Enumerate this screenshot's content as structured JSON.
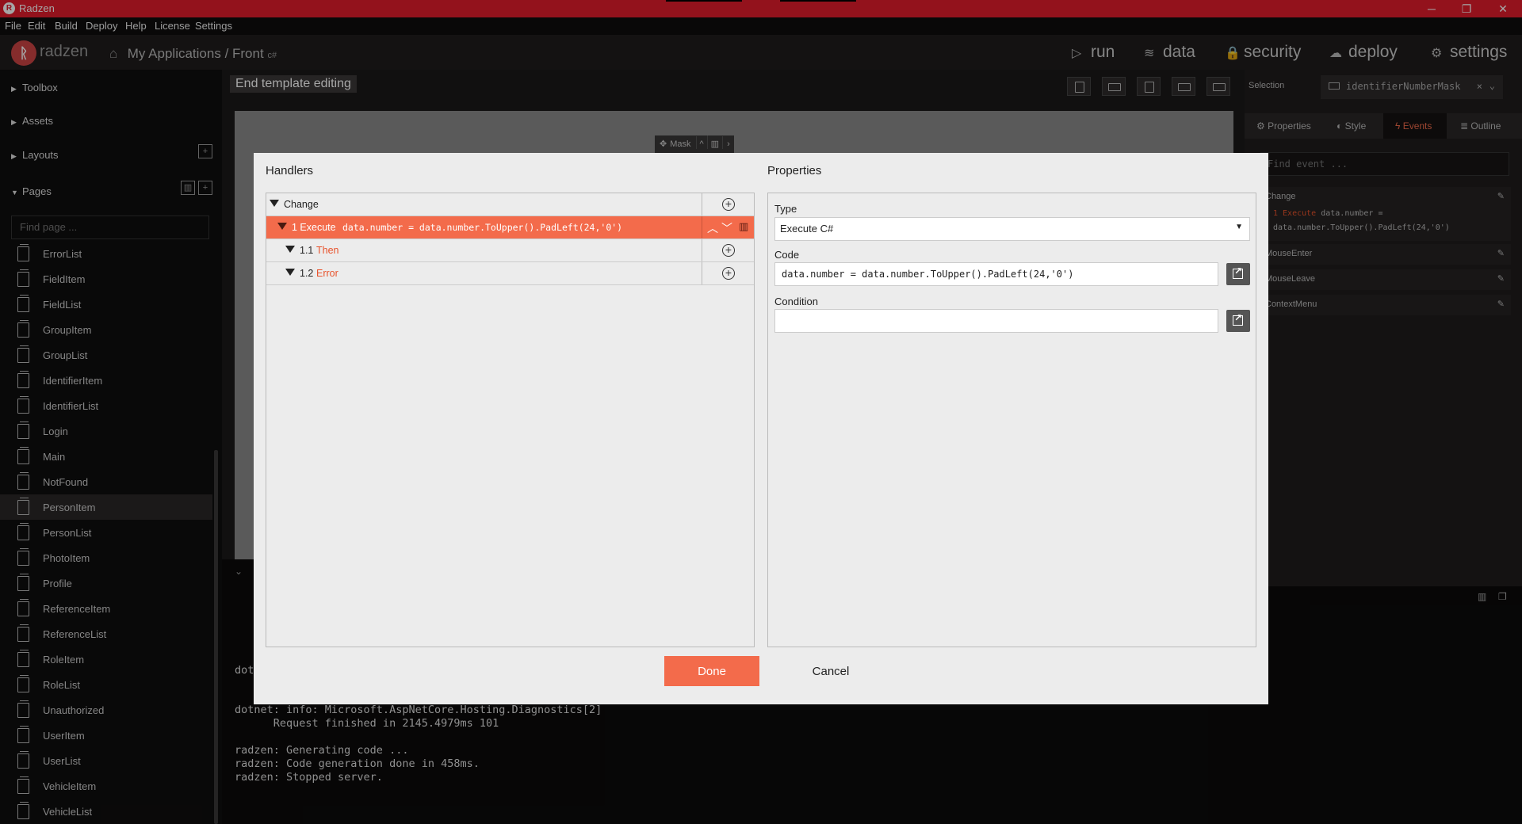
{
  "window": {
    "title": "Radzen",
    "logo_letter": "R"
  },
  "menu": [
    "File",
    "Edit",
    "Build",
    "Deploy",
    "Help",
    "License",
    "Settings"
  ],
  "header": {
    "brand": "radzen",
    "brand_icon": "radzen-logo",
    "breadcrumb": "My Applications / Front",
    "lang_badge": "c#",
    "nav": [
      {
        "label": "run",
        "icon": "play-icon"
      },
      {
        "label": "data",
        "icon": "layers-icon"
      },
      {
        "label": "security",
        "icon": "lock-icon"
      },
      {
        "label": "deploy",
        "icon": "cloud-upload-icon"
      },
      {
        "label": "settings",
        "icon": "gear-icon"
      }
    ]
  },
  "sidebar": {
    "sections": [
      "Toolbox",
      "Assets",
      "Layouts",
      "Pages"
    ],
    "find_placeholder": "Find page ...",
    "pages": [
      "ErrorList",
      "FieldItem",
      "FieldList",
      "GroupItem",
      "GroupList",
      "IdentifierItem",
      "IdentifierList",
      "Login",
      "Main",
      "NotFound",
      "PersonItem",
      "PersonList",
      "PhotoItem",
      "Profile",
      "ReferenceItem",
      "ReferenceList",
      "RoleItem",
      "RoleList",
      "Unauthorized",
      "UserItem",
      "UserList",
      "VehicleItem",
      "VehicleList"
    ],
    "active_page": "PersonItem"
  },
  "editor": {
    "end_template": "End template editing",
    "mask_label": "Mask",
    "console_partial": "dot",
    "console_lines": "dotnet: info: Microsoft.AspNetCore.Hosting.Diagnostics[2]\n      Request finished in 2145.4979ms 101\n\nradzen: Generating code ...\nradzen: Code generation done in 458ms.\nradzen: Stopped server."
  },
  "right_panel": {
    "selection_label": "Selection",
    "selection_value": "identifierNumberMask",
    "tabs": [
      "Properties",
      "Style",
      "Events",
      "Outline"
    ],
    "active_tab": "Events",
    "find_event_placeholder": "Find event ...",
    "events": [
      "Change",
      "MouseEnter",
      "MouseLeave",
      "ContextMenu"
    ],
    "change_detail_prefix": "1 Execute",
    "change_detail_code1": "data.number =",
    "change_detail_code2": "data.number.ToUpper().PadLeft(24,'0')"
  },
  "dialog": {
    "handlers_title": "Handlers",
    "properties_title": "Properties",
    "tree": {
      "root": "Change",
      "item1_prefix": "1 Execute",
      "item1_code": "data.number = data.number.ToUpper().PadLeft(24,'0')",
      "item11_num": "1.1",
      "item11_label": "Then",
      "item12_num": "1.2",
      "item12_label": "Error"
    },
    "type_label": "Type",
    "type_value": "Execute C#",
    "code_label": "Code",
    "code_value": "data.number = data.number.ToUpper().PadLeft(24,'0')",
    "condition_label": "Condition",
    "condition_value": "",
    "done": "Done",
    "cancel": "Cancel"
  }
}
